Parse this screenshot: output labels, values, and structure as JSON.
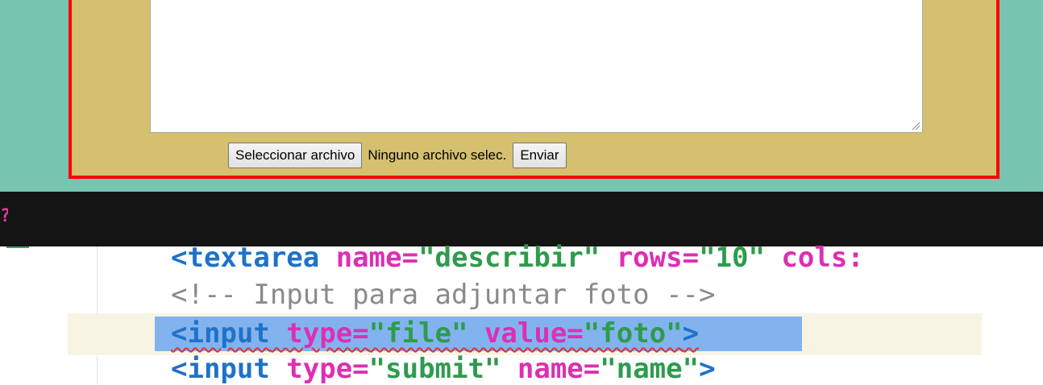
{
  "form": {
    "file_button_label": "Seleccionar archivo",
    "file_status": "Ninguno archivo selec.",
    "submit_label": "Enviar"
  },
  "editor": {
    "line1": {
      "open": "<textarea",
      "attr1": " name=",
      "val1": "\"describir\"",
      "attr2": " rows=",
      "val2": "\"10\"",
      "attr3": " cols:"
    },
    "line2": {
      "comment": "<!-- Input para adjuntar foto -->"
    },
    "line3": {
      "open": "<input",
      "attr1": " type=",
      "val1": "\"file\"",
      "attr2": " value=",
      "val2": "\"foto\"",
      "close": ">"
    },
    "line4": {
      "open": "<input",
      "attr1": " type=",
      "val1": "\"submit\"",
      "attr2": " name=",
      "val2": "\"name\"",
      "close": ">"
    }
  },
  "colors": {
    "page_background": "#77c4b1",
    "form_background": "#d4c06e",
    "form_border": "#ff0000",
    "code_tag": "#1f72c8",
    "code_attribute": "#dd2fb2",
    "code_string": "#2e9b4d",
    "code_comment": "#8a8a8a",
    "selection": "#82b3ef"
  }
}
